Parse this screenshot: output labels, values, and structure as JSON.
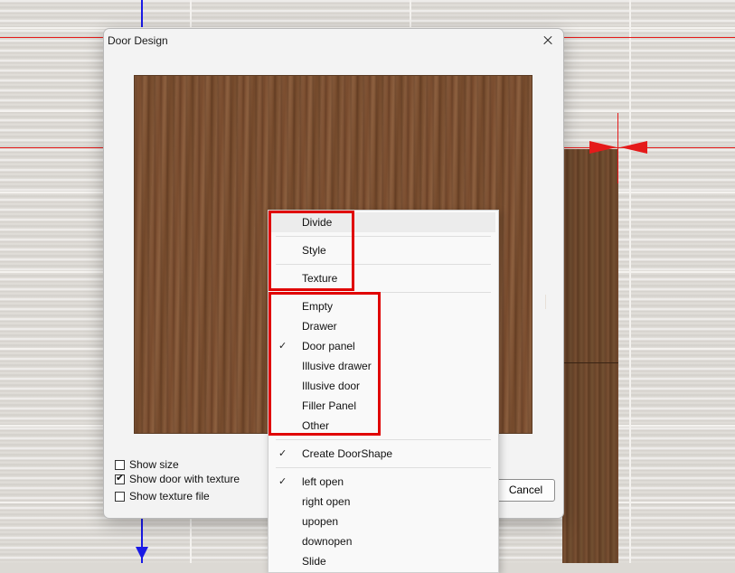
{
  "dialog": {
    "title": "Door Design",
    "options": [
      {
        "label": "Show size",
        "checked": false
      },
      {
        "label": "Show door with texture",
        "checked": true
      },
      {
        "label": "Show texture file",
        "checked": false
      }
    ],
    "cancel_label": "Cancel"
  },
  "menu": {
    "group1": [
      "Divide",
      "Style",
      "Texture"
    ],
    "group2": [
      {
        "label": "Empty",
        "checked": false
      },
      {
        "label": "Drawer",
        "checked": false
      },
      {
        "label": "Door panel",
        "checked": true
      },
      {
        "label": "Illusive drawer",
        "checked": false
      },
      {
        "label": "Illusive door",
        "checked": false
      },
      {
        "label": "Filler Panel",
        "checked": false
      },
      {
        "label": "Other",
        "checked": false
      }
    ],
    "group3": [
      {
        "label": "Create DoorShape",
        "checked": true
      }
    ],
    "group4": [
      {
        "label": "left open",
        "checked": true
      },
      {
        "label": "right open",
        "checked": false
      },
      {
        "label": "upopen",
        "checked": false
      },
      {
        "label": "downopen",
        "checked": false
      },
      {
        "label": "Slide",
        "checked": false
      }
    ],
    "check_glyph": "✓"
  },
  "colors": {
    "highlight_box": "#e00000",
    "guide_red": "#e51a1a",
    "guide_blue": "#1a1ae5"
  }
}
